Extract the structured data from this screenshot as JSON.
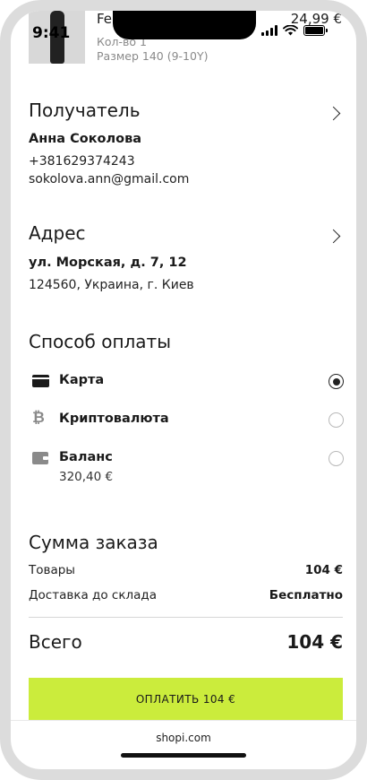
{
  "status_bar": {
    "time": "9:41"
  },
  "product": {
    "name": "Fe",
    "price": "24,99 €",
    "quantity": "Кол-во 1",
    "size": "Размер 140 (9-10Y)"
  },
  "recipient": {
    "title": "Получатель",
    "name": "Анна Соколова",
    "phone": "+381629374243",
    "email": "sokolova.ann@gmail.com"
  },
  "address": {
    "title": "Адрес",
    "street": "ул. Морская, д. 7, 12",
    "city": "124560, Украина, г. Киев"
  },
  "payment": {
    "title": "Способ оплаты",
    "options": [
      {
        "label": "Карта",
        "icon": "credit-card-icon",
        "selected": true
      },
      {
        "label": "Криптовалюта",
        "icon": "bitcoin-icon",
        "selected": false
      },
      {
        "label": "Баланс",
        "icon": "wallet-icon",
        "selected": false,
        "sublabel": "320,40 €"
      }
    ]
  },
  "summary": {
    "title": "Сумма заказа",
    "goods_label": "Товары",
    "goods_value": "104 €",
    "delivery_label": "Доставка до склада",
    "delivery_value": "Бесплатно",
    "total_label": "Всего",
    "total_value": "104 €"
  },
  "pay_button": {
    "label": "ОПЛАТИТЬ 104 €",
    "color": "#cbec3c"
  },
  "footer": {
    "domain": "shopi.com"
  }
}
